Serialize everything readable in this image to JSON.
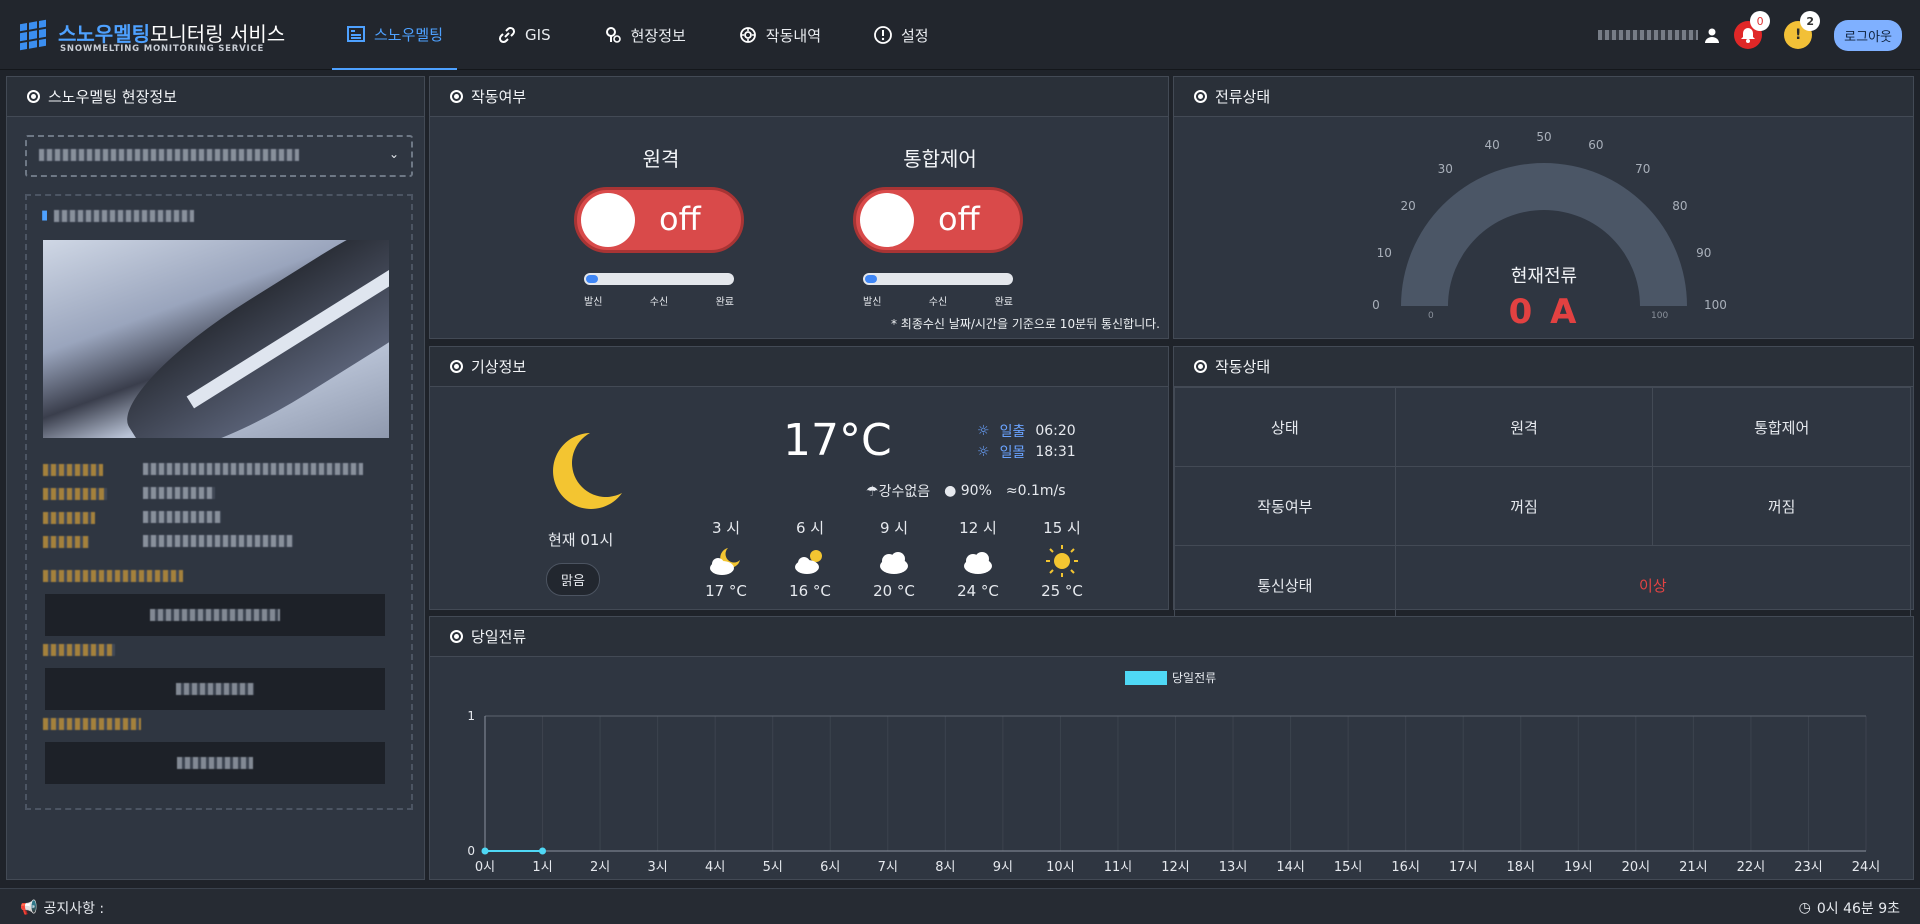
{
  "app": {
    "title_a": "스노우멜팅",
    "title_b": "모니터링 서비스",
    "subtitle": "SNOWMELTING MONITORING SERVICE"
  },
  "nav": [
    {
      "label": "스노우멜팅",
      "icon": "dashboard-icon",
      "active": true
    },
    {
      "label": "GIS",
      "icon": "link-icon"
    },
    {
      "label": "현장정보",
      "icon": "location-icon"
    },
    {
      "label": "작동내역",
      "icon": "history-icon"
    },
    {
      "label": "설정",
      "icon": "info-circle-icon"
    }
  ],
  "header_right": {
    "alarm_count": "0",
    "warning_count": "2",
    "logout": "로그아웃"
  },
  "site_panel": {
    "title": "스노우멜팅 현장정보"
  },
  "operation_panel": {
    "title": "작동여부",
    "controls": [
      {
        "title": "원격",
        "state": "off",
        "progress": 0.05
      },
      {
        "title": "통합제어",
        "state": "off",
        "progress": 0.05
      }
    ],
    "progress_labels": [
      "발신",
      "수신",
      "완료"
    ],
    "note": "* 최종수신 날짜/시간을 기준으로 10분뒤 통신합니다."
  },
  "current_panel": {
    "title": "전류상태",
    "gauge_label": "현재전류",
    "value": "0 A",
    "gauge_ticks": [
      "0",
      "10",
      "20",
      "30",
      "40",
      "50",
      "60",
      "70",
      "80",
      "90",
      "100"
    ],
    "gauge_min": "0",
    "gauge_max": "100"
  },
  "weather_panel": {
    "title": "기상정보",
    "now_label": "현재 01시",
    "condition": "맑음",
    "temperature": "17",
    "temperature_unit": "°C",
    "sunrise_label": "일출",
    "sunrise": "06:20",
    "sunset_label": "일몰",
    "sunset": "18:31",
    "precip": "강수없음",
    "humidity": "90%",
    "wind": "0.1m/s",
    "forecast": [
      {
        "hour": "3 시",
        "icon": "moon-cloud-icon",
        "temp": "17 °C"
      },
      {
        "hour": "6 시",
        "icon": "sun-cloud-icon",
        "temp": "16 °C"
      },
      {
        "hour": "9 시",
        "icon": "cloud-icon",
        "temp": "20 °C"
      },
      {
        "hour": "12 시",
        "icon": "cloud-icon",
        "temp": "24 °C"
      },
      {
        "hour": "15 시",
        "icon": "sun-icon",
        "temp": "25 °C"
      }
    ]
  },
  "status_panel": {
    "title": "작동상태",
    "headers": [
      "상태",
      "원격",
      "통합제어"
    ],
    "row1": [
      "작동여부",
      "꺼짐",
      "꺼짐"
    ],
    "row2_label": "통신상태",
    "row2_value": "이상"
  },
  "chart_panel": {
    "title": "당일전류"
  },
  "chart_data": {
    "type": "line",
    "legend": "당일전류",
    "legend_position": "top",
    "categories": [
      "0시",
      "1시",
      "2시",
      "3시",
      "4시",
      "5시",
      "6시",
      "7시",
      "8시",
      "9시",
      "10시",
      "11시",
      "12시",
      "13시",
      "14시",
      "15시",
      "16시",
      "17시",
      "18시",
      "19시",
      "20시",
      "21시",
      "22시",
      "23시",
      "24시"
    ],
    "series": [
      {
        "name": "당일전류",
        "values": [
          0,
          0
        ]
      }
    ],
    "ylim": [
      0,
      1
    ],
    "yticks": [
      "0",
      "1"
    ],
    "color": "#4fd8f5",
    "grid": true
  },
  "footer": {
    "notice_label": "공지사항 :",
    "time": "0시 46분 9초"
  }
}
